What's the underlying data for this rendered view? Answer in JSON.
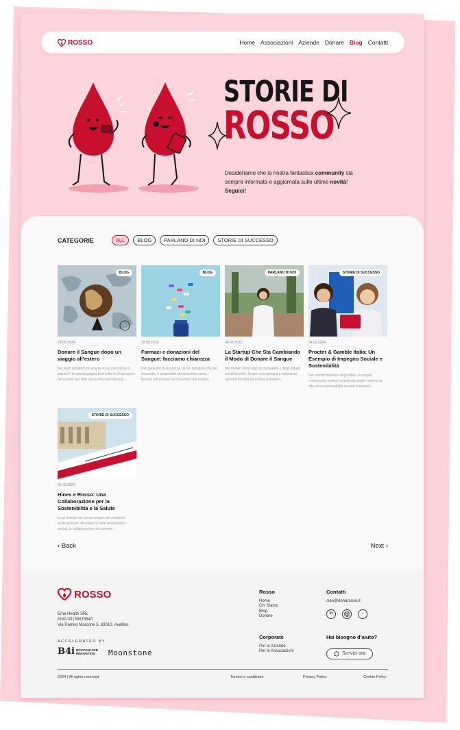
{
  "brand": {
    "name": "ROSSO",
    "color": "#c8102e",
    "pink": "#ffd5dd"
  },
  "nav": {
    "items": [
      {
        "label": "Home",
        "active": false
      },
      {
        "label": "Associazioni",
        "active": false
      },
      {
        "label": "Aziende",
        "active": false
      },
      {
        "label": "Donare",
        "active": false
      },
      {
        "label": "Blog",
        "active": true
      },
      {
        "label": "Contatti",
        "active": false
      }
    ]
  },
  "hero": {
    "title_line1": "STORIE DI",
    "title_line2": "ROSSO",
    "text_before": "Desideriamo che la nostra fantastica ",
    "text_bold1": "community",
    "text_mid": " sia sempre informata e aggiornata sulle ultime ",
    "text_bold2": "novità",
    "text_after": "!",
    "text_cta": "Seguici!"
  },
  "categories": {
    "title": "CATEGORIE",
    "pills": [
      {
        "label": "ALL",
        "active": true
      },
      {
        "label": "BLOG",
        "active": false
      },
      {
        "label": "PARLANO DI NOI",
        "active": false
      },
      {
        "label": "STORIE DI SUCCESSO",
        "active": false
      }
    ]
  },
  "posts": [
    {
      "badge": "BLOG",
      "date": "29.05.2024",
      "title": "Donare il Sangue dopo un viaggio all’estero",
      "excerpt": "Sei stato all’estero di recente o hai intenzione di andarci? In questa pagina trovi tutte le informazioni necessarie per fare una scelta consapevole...",
      "image": "globe-map"
    },
    {
      "badge": "BLOG",
      "date": "29.05.2024",
      "title": "Farmaci e donazioni del Sangue: facciamo chiarezza",
      "excerpt": "Per garantire la sicurezza sia del donatore che del ricevente, è essenziale comprendere come i farmaci influenzano la donazione del sangue...",
      "image": "pills"
    },
    {
      "badge": "PARLANO DI NOI",
      "date": "08.08.2023",
      "title": "La Startup Che Sta Cambiando il Modo di Donare il Sangue",
      "excerpt": "Nel mondo delle start up innovative e degli impatti sociali positivi, Rosso, una giovane e ambiziosa azienda fondata da Chiara Schettino...",
      "image": "woman-park"
    },
    {
      "badge": "STORIE DI SUCCESSO",
      "date": "04.02.2024",
      "title": "Procter & Gamble Italia: Un Esempio di Impegno Sociale e Sostenibilità",
      "excerpt": "Nel mondo frenetico degli affari, è sempre rinfrescante vedere un’azienda leader mettere in atto una responsabilità sociale d’impresa...",
      "image": "two-women"
    },
    {
      "badge": "STORIE DI SUCCESSO",
      "date": "04.02.2024",
      "title": "Hines e Rosso: Una Collaborazione per la Sostenibilità e la Salute",
      "excerpt": "In un mondo che cerca sempre più soluzioni sostenibili per affrontare le sfide ambientali e sociali, la collaborazione tra aziende...",
      "image": "building-flyer"
    }
  ],
  "pager": {
    "back": "Back",
    "next": "Next"
  },
  "footer": {
    "company": [
      "Ema Health SRL",
      "PIVA 03133670640",
      "Via Ramiro Marcone 5, 83010, Avellino"
    ],
    "accelerated": "ACCELERATED BY",
    "b4i_big": "B4i",
    "b4i_small1": "BOCCONI FOR",
    "b4i_small2": "INNOVATION",
    "moonstone": "Moonstone",
    "rosso_col": {
      "title": "Rosso",
      "links": [
        "Home",
        "Chi Siamo",
        "Blog",
        "Donare"
      ]
    },
    "corporate_col": {
      "title": "Corporate",
      "links": [
        "Per le Aziende",
        "Per le Associazioni"
      ]
    },
    "contact_col": {
      "title": "Contatti",
      "email": "ciao@donarosso.it",
      "socials": [
        "linkedin-icon",
        "instagram-icon",
        "tiktok-icon"
      ]
    },
    "help": {
      "title": "Hai bisogno d’aiuto?",
      "button": "Scrivici ora"
    },
    "bottom": {
      "copyright": "2024 | All rights reserved",
      "terms": "Termini e condizioni",
      "privacy": "Privacy Policy",
      "cookie": "Cookie Policy"
    }
  }
}
